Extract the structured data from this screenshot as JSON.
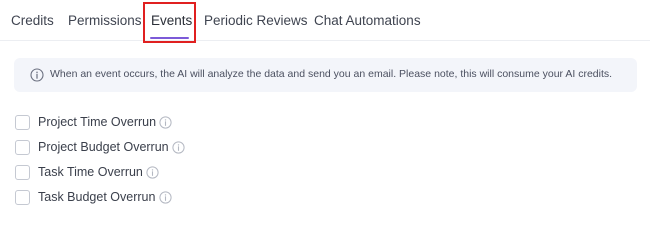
{
  "tabs": [
    {
      "label": "Credits",
      "active": false
    },
    {
      "label": "Permissions",
      "active": false
    },
    {
      "label": "Events",
      "active": true
    },
    {
      "label": "Periodic Reviews",
      "active": false
    },
    {
      "label": "Chat Automations",
      "active": false
    }
  ],
  "info": {
    "icon": "info-icon",
    "text": "When an event occurs, the AI will analyze the data and send you an email. Please note, this will consume your AI credits."
  },
  "events": [
    {
      "label": "Project Time Overrun",
      "checked": false,
      "help_icon": "info-circle-icon"
    },
    {
      "label": "Project Budget Overrun",
      "checked": false,
      "help_icon": "info-circle-icon"
    },
    {
      "label": "Task Time Overrun",
      "checked": false,
      "help_icon": "info-circle-icon"
    },
    {
      "label": "Task Budget Overrun",
      "checked": false,
      "help_icon": "info-circle-icon"
    }
  ],
  "colors": {
    "accent": "#7c5ad8",
    "highlight": "#e02020",
    "banner_bg": "#f3f5fa"
  }
}
